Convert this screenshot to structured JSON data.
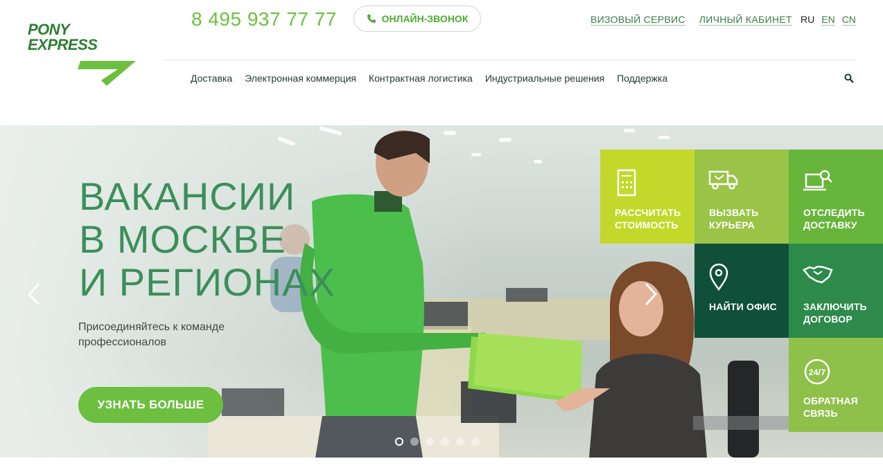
{
  "logo": {
    "line1": "PONY",
    "line2": "EXPRESS"
  },
  "header": {
    "phone": "8 495 937 77 77",
    "call_button": "ОНЛАЙН-ЗВОНОК",
    "links": [
      "ВИЗОВЫЙ СЕРВИС",
      "ЛИЧНЫЙ КАБИНЕТ"
    ],
    "languages": [
      {
        "code": "RU",
        "active": true
      },
      {
        "code": "EN",
        "active": false
      },
      {
        "code": "CN",
        "active": false
      }
    ]
  },
  "nav": {
    "items": [
      "Доставка",
      "Электронная коммерция",
      "Контрактная логистика",
      "Индустриальные решения",
      "Поддержка"
    ]
  },
  "hero": {
    "title_lines": [
      "ВАКАНСИИ",
      "В МОСКВЕ",
      "И РЕГИОНАХ"
    ],
    "subtitle": "Присоединяйтесь к команде профессионалов",
    "cta": "УЗНАТЬ БОЛЬШЕ",
    "slides_count": 6,
    "active_slide": 1
  },
  "tiles": [
    {
      "label1": "РАССЧИТАТЬ",
      "label2": "СТОИМОСТЬ",
      "icon": "calculator-icon",
      "color": "#c2d92b"
    },
    {
      "label1": "ВЫЗВАТЬ",
      "label2": "КУРЬЕРА",
      "icon": "truck-icon",
      "color": "#99c447"
    },
    {
      "label1": "ОТСЛЕДИТЬ",
      "label2": "ДОСТАВКУ",
      "icon": "laptop-search-icon",
      "color": "#67b53b"
    },
    {
      "label1": "НАЙТИ ОФИС",
      "label2": "",
      "icon": "location-pin-icon",
      "color": "#10503a"
    },
    {
      "label1": "ЗАКЛЮЧИТЬ",
      "label2": "ДОГОВОР",
      "icon": "handshake-icon",
      "color": "#2d8a4b"
    },
    {
      "label1": "ОБРАТНАЯ",
      "label2": "СВЯЗЬ",
      "icon": "support-24-7-icon",
      "color": "#8fc04a"
    }
  ],
  "colors": {
    "brand_green": "#6cbf3f",
    "dark_green": "#2e7d32",
    "link_green": "#3a7a46"
  }
}
